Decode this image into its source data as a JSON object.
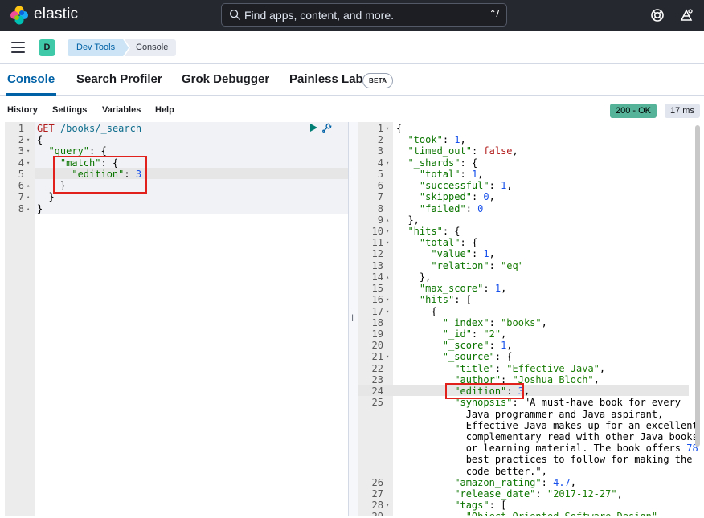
{
  "header": {
    "brand": "elastic",
    "search_placeholder": "Find apps, content, and more.",
    "shortcut": "⌃/"
  },
  "breadcrumb": {
    "avatar": "D",
    "items": [
      "Dev Tools",
      "Console"
    ]
  },
  "tabs": [
    {
      "label": "Console",
      "active": true
    },
    {
      "label": "Search Profiler",
      "active": false
    },
    {
      "label": "Grok Debugger",
      "active": false
    },
    {
      "label": "Painless Lab",
      "active": false,
      "badge": "BETA"
    }
  ],
  "toolbar": {
    "menu": [
      "History",
      "Settings",
      "Variables",
      "Help"
    ],
    "status": "200 - OK",
    "time": "17 ms"
  },
  "request_editor": {
    "lines": [
      {
        "num": "1",
        "fold": "",
        "text": "GET /books/_search"
      },
      {
        "num": "2",
        "fold": "▾",
        "text": "{"
      },
      {
        "num": "3",
        "fold": "▾",
        "text": "  \"query\": {"
      },
      {
        "num": "4",
        "fold": "▾",
        "text": "    \"match\": {"
      },
      {
        "num": "5",
        "fold": "",
        "text": "      \"edition\": 3"
      },
      {
        "num": "6",
        "fold": "▴",
        "text": "    }"
      },
      {
        "num": "7",
        "fold": "▴",
        "text": "  }"
      },
      {
        "num": "8",
        "fold": "▴",
        "text": "}"
      }
    ]
  },
  "response_editor": {
    "lines": [
      {
        "num": "1",
        "fold": "▾",
        "text": "{"
      },
      {
        "num": "2",
        "fold": "",
        "text": "  \"took\": 1,"
      },
      {
        "num": "3",
        "fold": "",
        "text": "  \"timed_out\": false,"
      },
      {
        "num": "4",
        "fold": "▾",
        "text": "  \"_shards\": {"
      },
      {
        "num": "5",
        "fold": "",
        "text": "    \"total\": 1,"
      },
      {
        "num": "6",
        "fold": "",
        "text": "    \"successful\": 1,"
      },
      {
        "num": "7",
        "fold": "",
        "text": "    \"skipped\": 0,"
      },
      {
        "num": "8",
        "fold": "",
        "text": "    \"failed\": 0"
      },
      {
        "num": "9",
        "fold": "▴",
        "text": "  },"
      },
      {
        "num": "10",
        "fold": "▾",
        "text": "  \"hits\": {"
      },
      {
        "num": "11",
        "fold": "▾",
        "text": "    \"total\": {"
      },
      {
        "num": "12",
        "fold": "",
        "text": "      \"value\": 1,"
      },
      {
        "num": "13",
        "fold": "",
        "text": "      \"relation\": \"eq\""
      },
      {
        "num": "14",
        "fold": "▴",
        "text": "    },"
      },
      {
        "num": "15",
        "fold": "",
        "text": "    \"max_score\": 1,"
      },
      {
        "num": "16",
        "fold": "▾",
        "text": "    \"hits\": ["
      },
      {
        "num": "17",
        "fold": "▾",
        "text": "      {"
      },
      {
        "num": "18",
        "fold": "",
        "text": "        \"_index\": \"books\","
      },
      {
        "num": "19",
        "fold": "",
        "text": "        \"_id\": \"2\","
      },
      {
        "num": "20",
        "fold": "",
        "text": "        \"_score\": 1,"
      },
      {
        "num": "21",
        "fold": "▾",
        "text": "        \"_source\": {"
      },
      {
        "num": "22",
        "fold": "",
        "text": "          \"title\": \"Effective Java\","
      },
      {
        "num": "23",
        "fold": "",
        "text": "          \"author\": \"Joshua Bloch\","
      },
      {
        "num": "24",
        "fold": "",
        "text": "          \"edition\": 3,"
      },
      {
        "num": "25",
        "fold": "",
        "text": "          \"synopsis\": \"A must-have book for every"
      },
      {
        "num": "",
        "fold": "",
        "text": "            Java programmer and Java aspirant,"
      },
      {
        "num": "",
        "fold": "",
        "text": "            Effective Java makes up for an excellent"
      },
      {
        "num": "",
        "fold": "",
        "text": "            complementary read with other Java books"
      },
      {
        "num": "",
        "fold": "",
        "text": "            or learning material. The book offers 78"
      },
      {
        "num": "",
        "fold": "",
        "text": "            best practices to follow for making the"
      },
      {
        "num": "",
        "fold": "",
        "text": "            code better.\","
      },
      {
        "num": "26",
        "fold": "",
        "text": "          \"amazon_rating\": 4.7,"
      },
      {
        "num": "27",
        "fold": "",
        "text": "          \"release_date\": \"2017-12-27\","
      },
      {
        "num": "28",
        "fold": "▾",
        "text": "          \"tags\": ["
      },
      {
        "num": "29",
        "fold": "",
        "text": "            \"Object Oriented Software Design\","
      }
    ]
  }
}
